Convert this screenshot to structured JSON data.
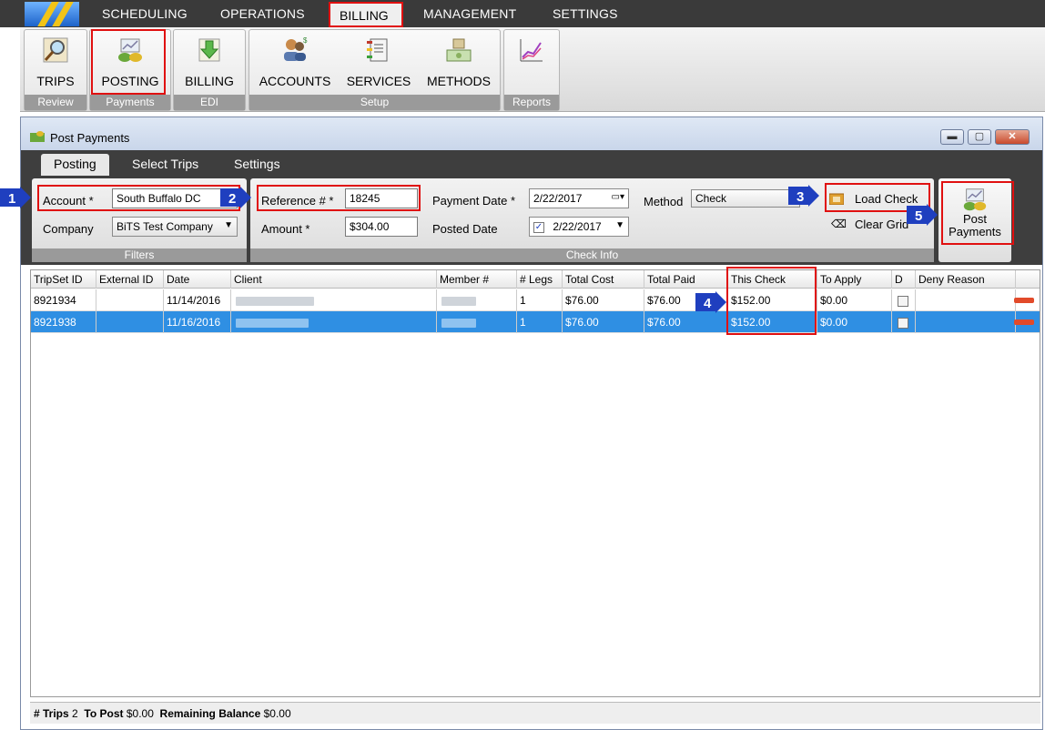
{
  "menu": {
    "items": [
      "SCHEDULING",
      "OPERATIONS",
      "BILLING",
      "MANAGEMENT",
      "SETTINGS"
    ],
    "active": "BILLING"
  },
  "ribbon": {
    "groups": [
      {
        "label": "Review",
        "buttons": [
          {
            "label": "TRIPS",
            "icon": "magnifier-icon"
          }
        ]
      },
      {
        "label": "Payments",
        "buttons": [
          {
            "label": "POSTING",
            "icon": "money-chart-icon"
          }
        ]
      },
      {
        "label": "EDI",
        "buttons": [
          {
            "label": "BILLING",
            "icon": "download-arrow-icon"
          }
        ]
      },
      {
        "label": "Setup",
        "buttons": [
          {
            "label": "ACCOUNTS",
            "icon": "users-icon"
          },
          {
            "label": "SERVICES",
            "icon": "notebook-icon"
          },
          {
            "label": "METHODS",
            "icon": "cash-icon"
          }
        ]
      },
      {
        "label": "Reports",
        "buttons": [
          {
            "label": "",
            "icon": "line-chart-icon"
          }
        ]
      }
    ]
  },
  "window": {
    "title": "Post Payments",
    "tabs": [
      "Posting",
      "Select Trips",
      "Settings"
    ],
    "active_tab": "Posting"
  },
  "filters": {
    "panel_label": "Filters",
    "account_label": "Account *",
    "account_value": "South Buffalo DC",
    "company_label": "Company",
    "company_value": "BiTS Test Company"
  },
  "check_info": {
    "panel_label": "Check Info",
    "reference_label": "Reference # *",
    "reference_value": "18245",
    "amount_label": "Amount *",
    "amount_value": "$304.00",
    "payment_date_label": "Payment Date *",
    "payment_date_value": "2/22/2017",
    "posted_date_label": "Posted Date",
    "posted_date_value": "2/22/2017",
    "posted_date_checked": true,
    "method_label": "Method",
    "method_value": "Check",
    "load_check_label": "Load Check",
    "clear_grid_label": "Clear Grid",
    "post_payments_label_1": "Post",
    "post_payments_label_2": "Payments"
  },
  "markers": [
    "1",
    "2",
    "3",
    "4",
    "5"
  ],
  "grid": {
    "columns": [
      "TripSet ID",
      "External ID",
      "Date",
      "Client",
      "Member #",
      "# Legs",
      "Total Cost",
      "Total Paid",
      "This Check",
      "To Apply",
      "D",
      "Deny Reason"
    ],
    "rows": [
      {
        "tripset_id": "8921934",
        "external_id": "",
        "date": "11/14/2016",
        "legs": "1",
        "total_cost": "$76.00",
        "total_paid": "$76.00",
        "this_check": "$152.00",
        "to_apply": "$0.00",
        "deny_reason": ""
      },
      {
        "tripset_id": "8921938",
        "external_id": "",
        "date": "11/16/2016",
        "legs": "1",
        "total_cost": "$76.00",
        "total_paid": "$76.00",
        "this_check": "$152.00",
        "to_apply": "$0.00",
        "deny_reason": ""
      }
    ]
  },
  "status": {
    "trips_label": "# Trips",
    "trips_value": "2",
    "to_post_label": "To Post",
    "to_post_value": "$0.00",
    "remaining_label": "Remaining Balance",
    "remaining_value": "$0.00"
  },
  "colors": {
    "highlight_red": "#e01010",
    "marker_blue": "#1f3fbf",
    "selected_row": "#2f8fe3",
    "menubar": "#3a3a3a"
  }
}
